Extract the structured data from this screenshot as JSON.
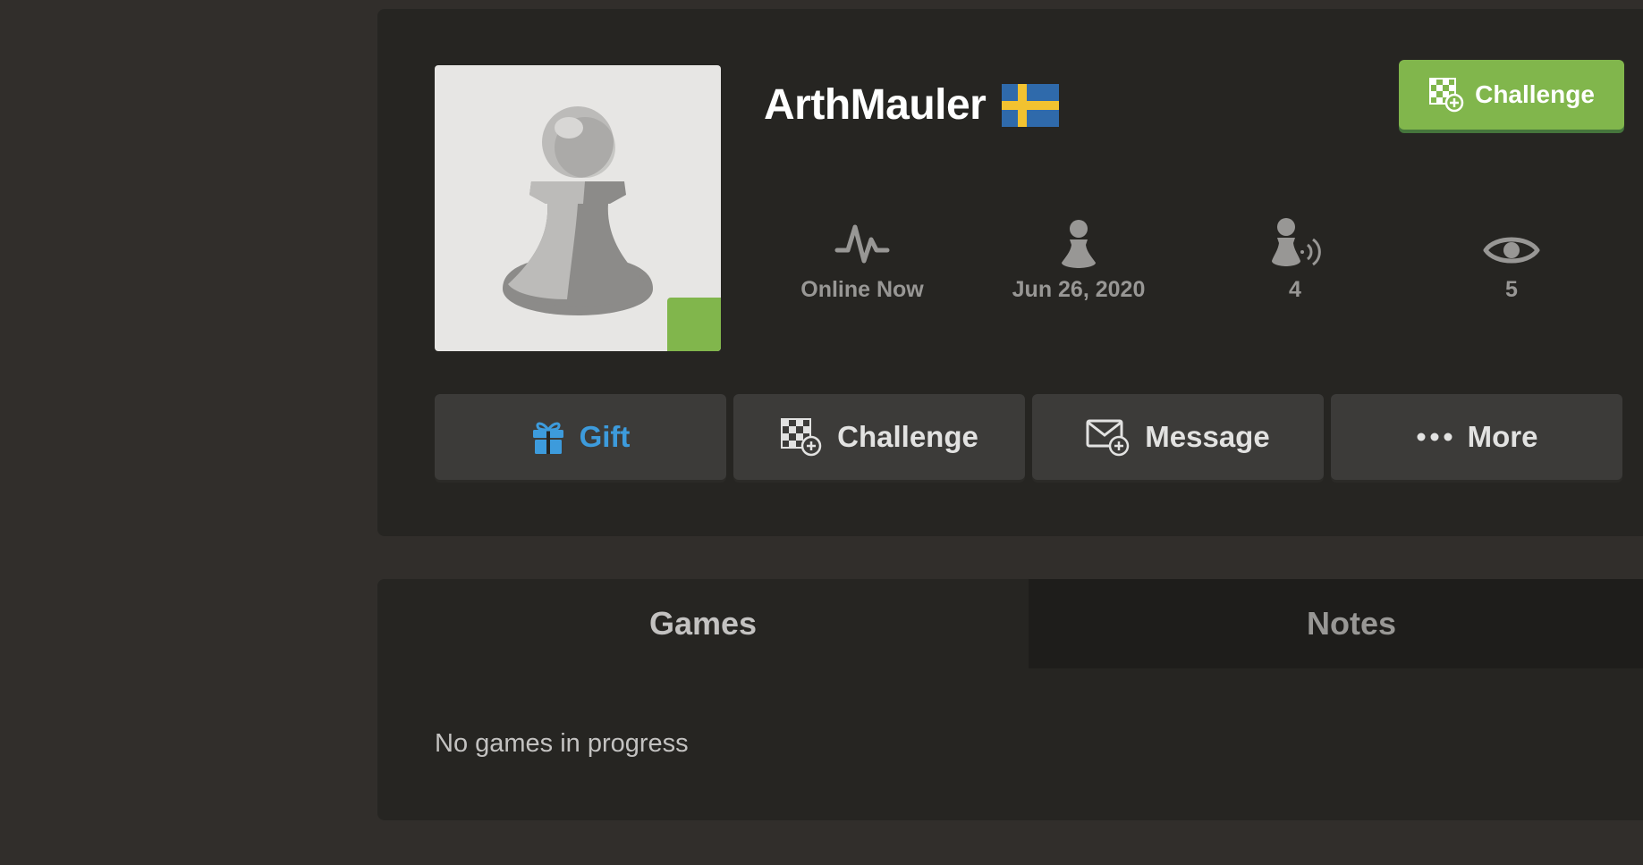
{
  "profile": {
    "username": "ArthMauler",
    "country_flag": "sweden-flag",
    "online_status_color": "#81b64c",
    "challenge_button_label": "Challenge",
    "stats": [
      {
        "icon": "activity-pulse-icon",
        "value": "Online Now"
      },
      {
        "icon": "pawn-joined-icon",
        "value": "Jun 26, 2020"
      },
      {
        "icon": "followers-icon",
        "value": "4"
      },
      {
        "icon": "eye-views-icon",
        "value": "5"
      }
    ],
    "actions": [
      {
        "icon": "gift-icon",
        "label": "Gift"
      },
      {
        "icon": "challenge-board-icon",
        "label": "Challenge"
      },
      {
        "icon": "message-icon",
        "label": "Message"
      },
      {
        "icon": "more-dots-icon",
        "label": "More"
      }
    ]
  },
  "tabs": [
    {
      "label": "Games",
      "active": true
    },
    {
      "label": "Notes",
      "active": false
    }
  ],
  "games_panel": {
    "empty_message": "No games in progress"
  },
  "colors": {
    "background": "#312e2b",
    "card": "#262522",
    "accent_green": "#81b64c",
    "gift_blue": "#3d9bdc"
  }
}
